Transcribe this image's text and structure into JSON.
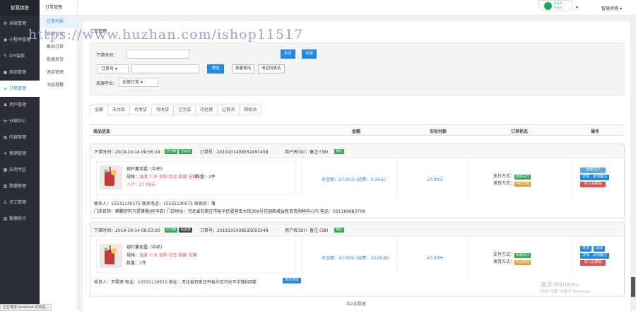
{
  "sidebar": {
    "logo": "智慧拼搭",
    "items": [
      {
        "label": "系统管理",
        "icon": "gear-icon",
        "glyph": "⚙"
      },
      {
        "label": "小程序管理",
        "icon": "miniapp-icon",
        "glyph": "◉"
      },
      {
        "label": "DIY装修",
        "icon": "brush-icon",
        "glyph": "✎"
      },
      {
        "label": "商品管理",
        "icon": "box-icon",
        "glyph": "▣"
      },
      {
        "label": "订单管理",
        "icon": "order-icon",
        "glyph": "≡"
      },
      {
        "label": "用户管理",
        "icon": "user-icon",
        "glyph": "♟"
      },
      {
        "label": "分销中心",
        "icon": "share-icon",
        "glyph": "⇆"
      },
      {
        "label": "内容管理",
        "icon": "content-icon",
        "glyph": "▤"
      },
      {
        "label": "营销管理",
        "icon": "marketing-icon",
        "glyph": "✦"
      },
      {
        "label": "应用专区",
        "icon": "apps-icon",
        "glyph": "▦"
      },
      {
        "label": "数据管理",
        "icon": "data-icon",
        "glyph": "▥"
      },
      {
        "label": "员工管理",
        "icon": "staff-icon",
        "glyph": "♙"
      },
      {
        "label": "数据统计",
        "icon": "stats-icon",
        "glyph": "▨"
      }
    ]
  },
  "submenu": {
    "title": "订单管理",
    "items": [
      "订单列表",
      "自提订单",
      "售后订单",
      "批量发货",
      "退款管理",
      "消息提醒"
    ]
  },
  "topbar": {
    "user1": "智慧拼搭 ▾",
    "user2": "▾"
  },
  "wifi": {
    "line1": "0 K/s",
    "line2": "0 K/s"
  },
  "watermark": "https://www.huzhan.com/ishop11517",
  "main": {
    "breadcrumb": "订单管理"
  },
  "filter": {
    "label": "下单时间：",
    "btn1": "本月",
    "btn2": "本周",
    "order_type": "订单号",
    "search": "筛选",
    "export": "批量导出",
    "clear": "清空回收站",
    "source_label": "来源平台：",
    "source_value": "全部订单"
  },
  "tabs": [
    "全部",
    "未付款",
    "待发货",
    "待收货",
    "已完成",
    "待处理",
    "已取消",
    "回收站"
  ],
  "columns": {
    "goods": "商品信息",
    "amount": "金额",
    "paid": "实际付款",
    "status": "订单状态",
    "action": "操作"
  },
  "orders": [
    {
      "time": "下单时间：2019-10-14 08:56:24",
      "tag1": "已付款",
      "tag2": "已收货",
      "no": "订单号：2019101408552497458",
      "user": "用户名(ID)：备注 (38)",
      "tag_user": "微信",
      "product": "柳柠薯条霜（中杯）",
      "spec_label": "规格：",
      "spec": "温度 少冰  加料 红豆  甜度 无糖",
      "qty": "数量：1件",
      "subtotal": "小计：27.00元",
      "total": "总金额：27.00元 (运费：0.00元)",
      "paid": "27.00元",
      "pay_method": "支付方式：",
      "pay_tag": "余额支付",
      "ship_method": "发货方式：",
      "ship_tag": "到店自提",
      "actions": [
        "全部打印",
        "详情",
        "添加备注",
        "导入回收站"
      ],
      "contact": "联系人：15531130575   联系电话：15531130575   核销员：蒲",
      "store": "门店名称：麒麟宫阿凡提饕餮(经中店)   门店地址：河北省石家庄市裕华区翟营南大街366号花园商城益新百货购物中心内   电话：031189683708"
    },
    {
      "time": "下单时间：2019-10-14 08:53:50",
      "tag1": "已付款",
      "tag2": "未发货",
      "no": "订单号：2019101408535055549",
      "user": "用户名(ID)：备注 (38)",
      "tag_user": "微信",
      "product": "柳柠薯条霜（中杯）",
      "spec_label": "规格：",
      "spec": "温度 少冰  加料 红豆  甜度 全糖",
      "qty": "数量：1件",
      "subtotal": "小计：27.00元",
      "total": "总金额：47.00元 (运费：20.00元)",
      "paid": "47.00元",
      "pay_method": "支付方式：",
      "pay_tag": "余额支付",
      "ship_method": "发货方式：",
      "ship_tag": "快递配送",
      "actions": [
        "发货",
        "取消",
        "详情",
        "添加备注",
        "导入回收站"
      ],
      "receiver": "收货人：尹霞贤   电话：15531130572   地址：河北省石家庄市裕华区万达写字楼B四楼",
      "edit_addr": "修改地址"
    }
  ],
  "footer": "共2条数据",
  "windows": {
    "line1": "激活 Windows",
    "line2": "转到\"设置\"以激活 Windows。"
  },
  "statusbar": "正在等待 localhost 的响应..."
}
